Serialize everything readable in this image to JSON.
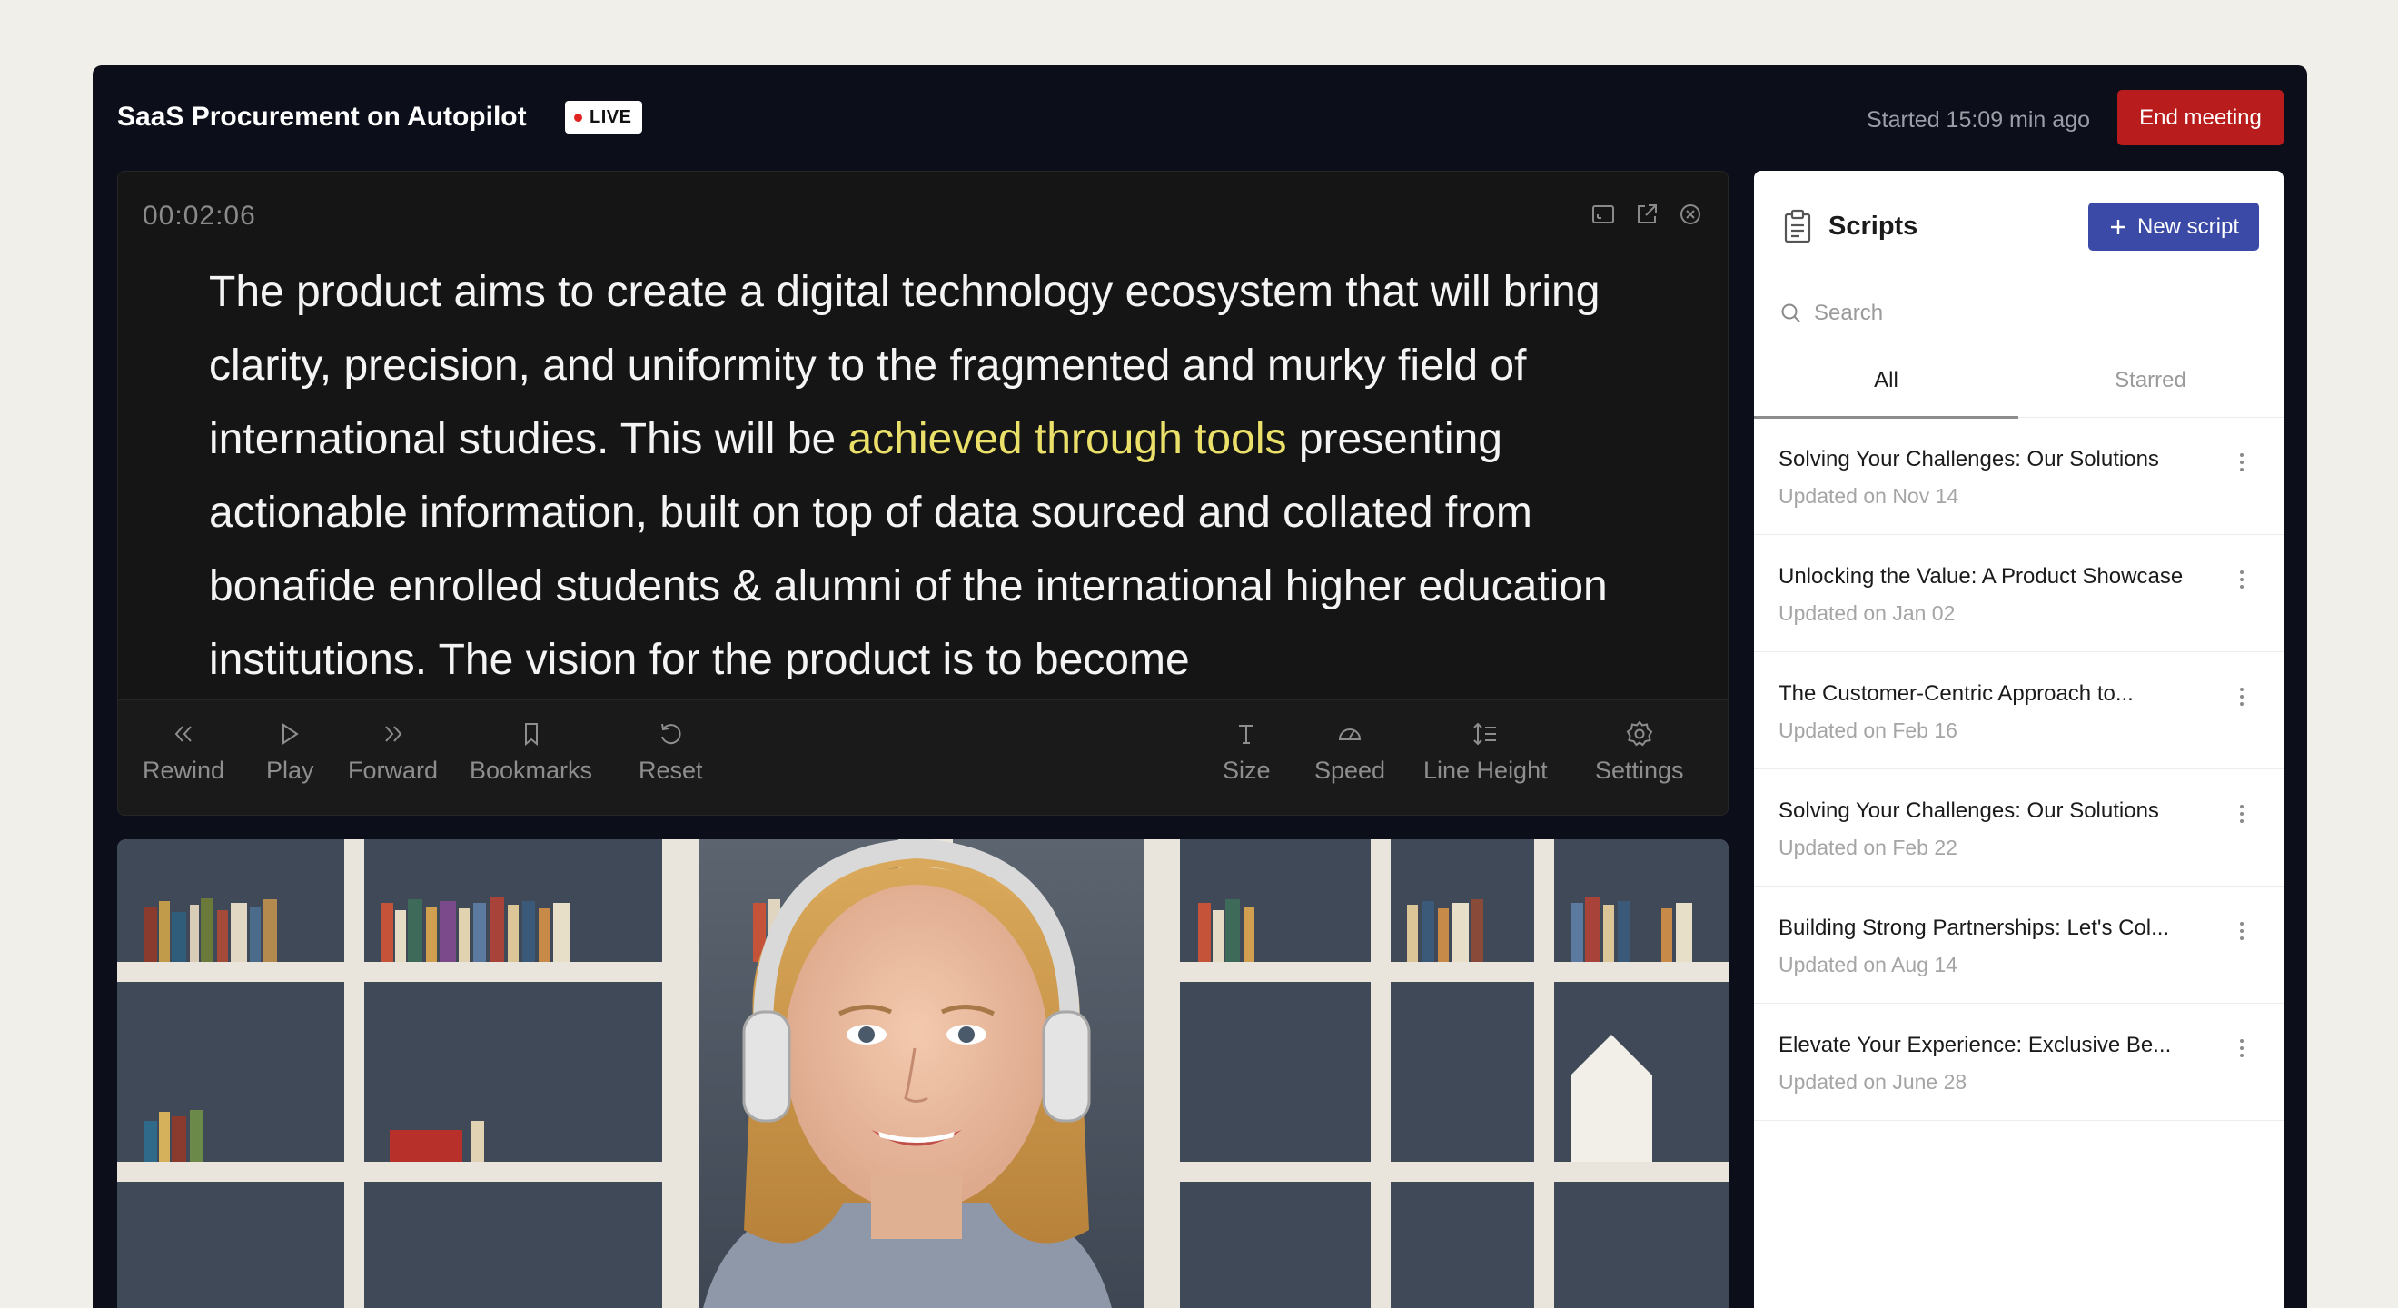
{
  "header": {
    "title": "SaaS Procurement on Autopilot",
    "live_label": "LIVE",
    "started_text": "Started 15:09 min ago",
    "end_button": "End meeting"
  },
  "prompter": {
    "timer": "00:02:06",
    "text_before": "The product aims to create a digital technology ecosystem that will bring clarity, precision, and uniformity to the fragmented and murky field of international studies. This will be ",
    "text_highlight": "achieved through tools",
    "text_after": " presenting actionable information, built on top of data sourced and collated from bonafide enrolled students & alumni of the international higher education institutions. The vision for the product is to become",
    "highlight_color": "#ebe06a",
    "controls": {
      "rewind": "Rewind",
      "play": "Play",
      "forward": "Forward",
      "bookmarks": "Bookmarks",
      "reset": "Reset",
      "size": "Size",
      "speed": "Speed",
      "line_height": "Line Height",
      "settings": "Settings"
    }
  },
  "panel": {
    "title": "Scripts",
    "new_button": "New script",
    "search_placeholder": "Search",
    "tabs": [
      "All",
      "Starred"
    ],
    "items": [
      {
        "name": "Solving Your Challenges: Our Solutions",
        "date": "Updated on Nov 14"
      },
      {
        "name": "Unlocking the Value: A Product Showcase",
        "date": "Updated on Jan 02"
      },
      {
        "name": "The Customer-Centric Approach to...",
        "date": "Updated on Feb 16"
      },
      {
        "name": "Solving Your Challenges: Our Solutions",
        "date": "Updated on Feb 22"
      },
      {
        "name": "Building Strong Partnerships: Let's Col...",
        "date": "Updated on Aug 14"
      },
      {
        "name": "Elevate Your Experience: Exclusive Be...",
        "date": "Updated on June 28"
      }
    ]
  },
  "colors": {
    "accent": "#3b4aa6",
    "danger": "#b91c1c",
    "live_dot": "#e02424"
  }
}
